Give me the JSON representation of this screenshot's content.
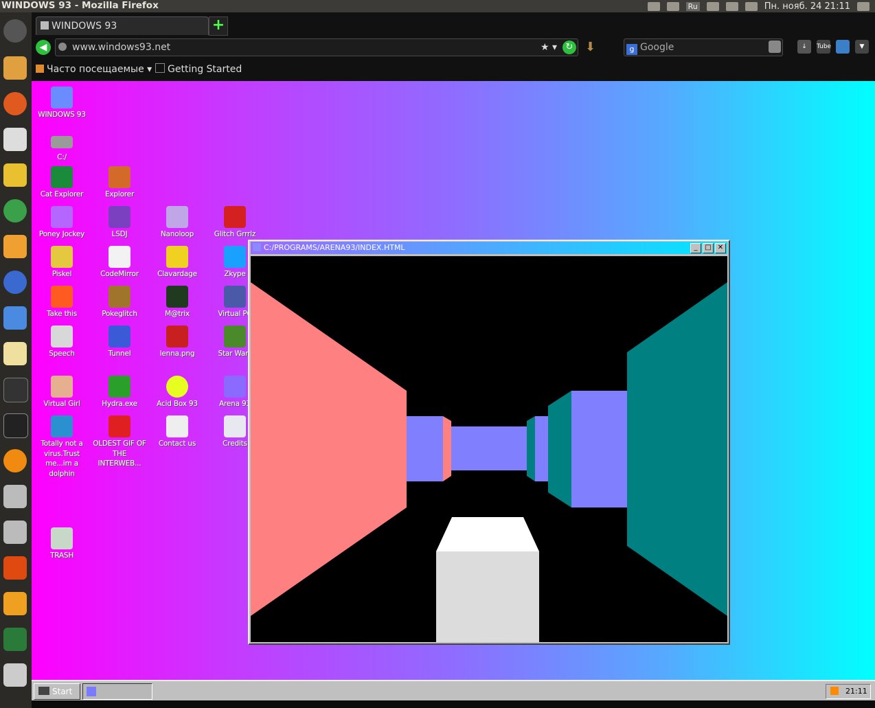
{
  "os_panel": {
    "window_title": "WINDOWS 93 - Mozilla Firefox",
    "language": "Ru",
    "clock": "Пн. нояб. 24 21:11"
  },
  "browser": {
    "tab_title": "WINDOWS 93",
    "new_tab": "+",
    "url": "www.windows93.net",
    "search_placeholder": "Google",
    "bookmarks": [
      "Часто посещаемые ▾",
      "Getting Started"
    ]
  },
  "desktop": {
    "icons": [
      {
        "label": "WINDOWS 93",
        "color": "#6a8cff"
      },
      {
        "label": "C:/",
        "color": "#9a9a9a"
      },
      {
        "label": "Cat Explorer",
        "color": "#1a8b3a"
      },
      {
        "label": "Explorer",
        "color": "#d46a2a"
      },
      {
        "label": "Poney Jockey",
        "color": "#b566ff"
      },
      {
        "label": "LSDJ",
        "color": "#7a40c0"
      },
      {
        "label": "Nanoloop",
        "color": "#c0a6e6"
      },
      {
        "label": "Glitch Grrrlz",
        "color": "#d42020"
      },
      {
        "label": "Piskel",
        "color": "#e3c840"
      },
      {
        "label": "CodeMirror",
        "color": "#f2f2f2"
      },
      {
        "label": "Clavardage",
        "color": "#f0d020"
      },
      {
        "label": "Zkype",
        "color": "#1aa0ff"
      },
      {
        "label": "Take this",
        "color": "#ff5a20"
      },
      {
        "label": "Pokeglitch",
        "color": "#a0742a"
      },
      {
        "label": "M@trix",
        "color": "#1f3a1f"
      },
      {
        "label": "Virtual PC",
        "color": "#4a5aa8"
      },
      {
        "label": "Speech",
        "color": "#d8d8d8"
      },
      {
        "label": "Tunnel",
        "color": "#3a5ad8"
      },
      {
        "label": "lenna.png",
        "color": "#c82020"
      },
      {
        "label": "Star Wars",
        "color": "#4a8a2a"
      },
      {
        "label": "Virtual Girl",
        "color": "#e6b090"
      },
      {
        "label": "Hydra.exe",
        "color": "#2aa02a"
      },
      {
        "label": "Acid Box 93",
        "color": "#e6ff20"
      },
      {
        "label": "Arena 93",
        "color": "#8a6aff"
      },
      {
        "label": "Totally not a virus.Trust me...im a dolphin",
        "color": "#2a90d0"
      },
      {
        "label": "OLDEST GIF OF THE INTERWEB...",
        "color": "#e02020"
      },
      {
        "label": "Contact us",
        "color": "#eeeeee"
      },
      {
        "label": "Credits",
        "color": "#e8e8f0"
      },
      {
        "label": "TRASH",
        "color": "#c8d8c8"
      }
    ]
  },
  "arena_window": {
    "title": "C:/PROGRAMS/ARENA93/INDEX.HTML",
    "buttons": [
      "_",
      "□",
      "✕"
    ]
  },
  "taskbar": {
    "start_label": "Start",
    "tray_time": "21:11"
  },
  "colors": {
    "wall_left": "#ff8080",
    "wall_right": "#008080",
    "wall_front": "#8080ff",
    "box_top": "#ffffff",
    "box_front": "#dcdcdc"
  }
}
